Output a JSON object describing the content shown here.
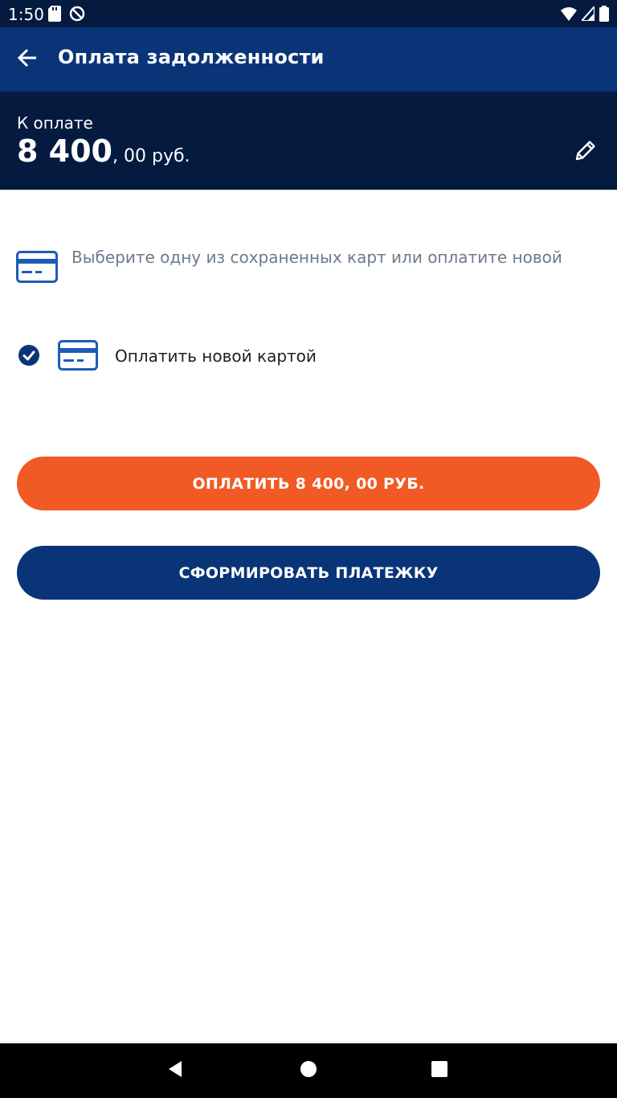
{
  "status_bar": {
    "time": "1:50"
  },
  "app_bar": {
    "title": "Оплата задолженности"
  },
  "amount": {
    "label": "К оплате",
    "main": "8 400",
    "tail": ", 00 руб."
  },
  "hint": {
    "text": "Выберите одну из сохраненных карт или оплатите новой"
  },
  "card_option": {
    "label": "Оплатить новой картой",
    "selected": true
  },
  "buttons": {
    "pay_label": "ОПЛАТИТЬ 8 400, 00 РУБ.",
    "form_label": "СФОРМИРОВАТЬ ПЛАТЕЖКУ"
  },
  "icons": {
    "back": "arrow-back-icon",
    "edit": "pencil-icon",
    "card": "credit-card-icon",
    "check": "check-circle-icon",
    "nav_back": "triangle-back-icon",
    "nav_home": "circle-home-icon",
    "nav_recents": "square-recents-icon"
  },
  "colors": {
    "status_bar": "#041a3f",
    "app_bar": "#0a3478",
    "amount_panel": "#041a3f",
    "accent_orange": "#f15a24",
    "primary_blue": "#0a3478",
    "card_icon": "#1e5bb8",
    "hint_text": "#6b7a8c"
  }
}
